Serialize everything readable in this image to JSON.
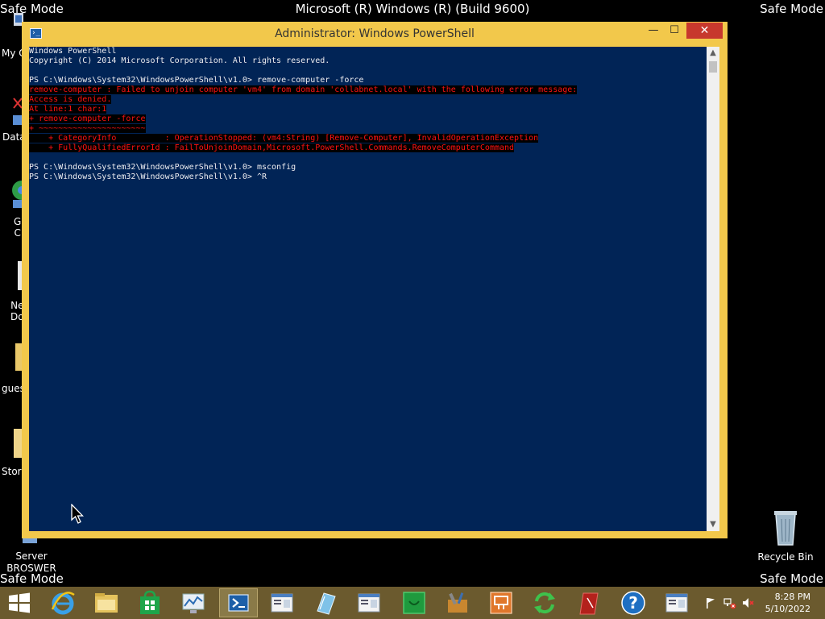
{
  "desktop": {
    "safe_mode_label": "Safe Mode",
    "build_label": "Microsoft (R) Windows (R) (Build 9600)",
    "icons": [
      {
        "label": "My C"
      },
      {
        "label": "Data"
      },
      {
        "label": "G\nC"
      },
      {
        "label": "Ne\nDo"
      },
      {
        "label": "gues"
      },
      {
        "label": "Stora"
      },
      {
        "label": "Server\nBROSWER"
      },
      {
        "label": "Recycle Bin"
      }
    ]
  },
  "window": {
    "title": "Administrator: Windows PowerShell",
    "controls": {
      "minimize": "—",
      "maximize": "☐",
      "close": "✕"
    }
  },
  "console": {
    "lines": [
      {
        "text": "Windows PowerShell",
        "type": "normal"
      },
      {
        "text": "Copyright (C) 2014 Microsoft Corporation. All rights reserved.",
        "type": "normal"
      },
      {
        "text": "",
        "type": "normal"
      },
      {
        "text": "PS C:\\Windows\\System32\\WindowsPowerShell\\v1.0> remove-computer -force",
        "type": "normal"
      },
      {
        "text": "remove-computer : Failed to unjoin computer 'vm4' from domain 'collabnet.local' with the following error message:",
        "type": "error"
      },
      {
        "text": "Access is denied.",
        "type": "error"
      },
      {
        "text": "At line:1 char:1",
        "type": "error"
      },
      {
        "text": "+ remove-computer -force",
        "type": "error"
      },
      {
        "text": "+ ~~~~~~~~~~~~~~~~~~~~~~",
        "type": "error"
      },
      {
        "text": "    + CategoryInfo          : OperationStopped: (vm4:String) [Remove-Computer], InvalidOperationException",
        "type": "error"
      },
      {
        "text": "    + FullyQualifiedErrorId : FailToUnjoinDomain,Microsoft.PowerShell.Commands.RemoveComputerCommand",
        "type": "error"
      },
      {
        "text": "",
        "type": "normal"
      },
      {
        "text": "PS C:\\Windows\\System32\\WindowsPowerShell\\v1.0> msconfig",
        "type": "normal"
      },
      {
        "text": "PS C:\\Windows\\System32\\WindowsPowerShell\\v1.0> ^R",
        "type": "normal"
      }
    ]
  },
  "taskbar": {
    "buttons": [
      {
        "name": "start-button",
        "icon": "windows-logo-icon"
      },
      {
        "name": "internet-explorer-button",
        "icon": "internet-explorer-icon"
      },
      {
        "name": "file-explorer-button",
        "icon": "folder-icon"
      },
      {
        "name": "store-button",
        "icon": "store-icon"
      },
      {
        "name": "performance-monitor-button",
        "icon": "monitor-chart-icon"
      },
      {
        "name": "powershell-button",
        "icon": "powershell-icon",
        "active": true
      },
      {
        "name": "document-app-button",
        "icon": "document-window-icon"
      },
      {
        "name": "notepad-button",
        "icon": "notepad-icon"
      },
      {
        "name": "window-app-button",
        "icon": "document-window-icon"
      },
      {
        "name": "green-app-button",
        "icon": "green-box-icon"
      },
      {
        "name": "tools-button",
        "icon": "toolbox-icon"
      },
      {
        "name": "orange-app-button",
        "icon": "orange-box-icon"
      },
      {
        "name": "sync-button",
        "icon": "sync-arrows-icon"
      },
      {
        "name": "red-book-button",
        "icon": "red-book-icon"
      },
      {
        "name": "help-button",
        "icon": "help-icon"
      },
      {
        "name": "window-app-2-button",
        "icon": "document-window-icon"
      }
    ],
    "clock": {
      "time": "8:28 PM",
      "date": "5/10/2022"
    }
  }
}
